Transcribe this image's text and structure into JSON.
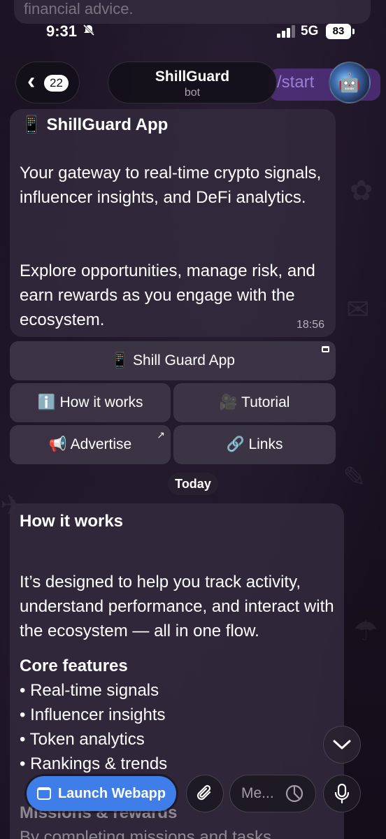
{
  "status_bar": {
    "time": "9:31",
    "network": "5G",
    "battery": "83",
    "peek_text": "financial advice."
  },
  "header": {
    "back_count": "22",
    "title": "ShillGuard",
    "subtitle": "bot",
    "start_ghost": "/start"
  },
  "message1": {
    "heading": "📱 ShillGuard App",
    "para1": "Your gateway to real-time crypto signals, influencer insights, and DeFi analytics.",
    "para2": "Explore opportunities, manage risk, and earn rewards as you engage with the ecosystem.",
    "time": "18:56"
  },
  "keyboard": {
    "app": "📱 Shill Guard App",
    "how": "ℹ️ How it works",
    "tutorial": "🎥 Tutorial",
    "advertise": "📢 Advertise",
    "links": "🔗 Links"
  },
  "date_divider": "Today",
  "message2": {
    "heading": "How it works",
    "para1": "It’s designed to help you track activity, understand performance, and interact with the ecosystem — all in one flow.",
    "core_heading": "Core features",
    "features": [
      "• Real-time signals",
      "• Influencer insights",
      "• Token analytics",
      "• Rankings & trends"
    ],
    "missions_heading": "Missions & rewards",
    "missions_text": "By completing missions and tasks"
  },
  "bottom_bar": {
    "launch_label": "Launch Webapp",
    "input_placeholder": "Me..."
  }
}
